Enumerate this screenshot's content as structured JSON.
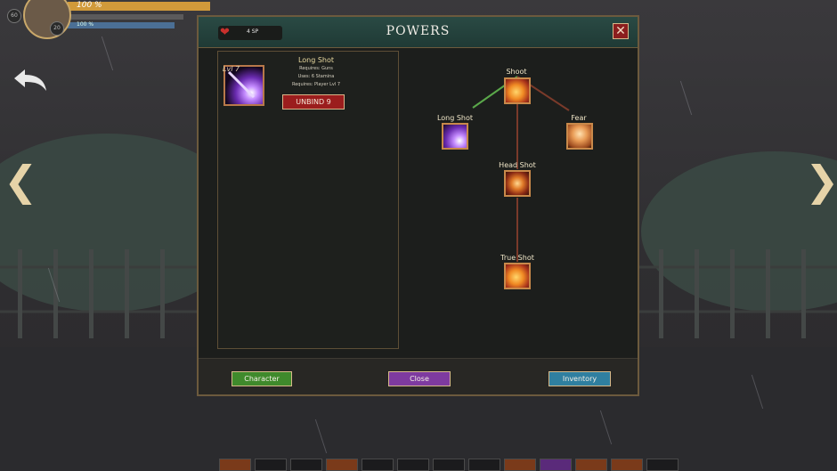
{
  "hud": {
    "hp_text": "100 %",
    "hp_fill_fraction": 1.0,
    "mana_text": "100 %",
    "level_badge_1": "60",
    "level_badge_2": "20"
  },
  "dialog": {
    "title": "POWERS",
    "sp_text": "4 SP",
    "close_symbol": "✕",
    "selected_power": {
      "level_label": "Lvl 7",
      "name": "Long Shot",
      "requires_weapon": "Requires: Guns",
      "uses": "Uses: 6 Stamina",
      "requires_level": "Requires: Player Lvl 7",
      "unbind_label": "UNBIND 9"
    },
    "tree": {
      "nodes": [
        {
          "id": "shoot",
          "label": "Shoot"
        },
        {
          "id": "long-shot",
          "label": "Long Shot"
        },
        {
          "id": "fear",
          "label": "Fear"
        },
        {
          "id": "head-shot",
          "label": "Head Shot"
        },
        {
          "id": "true-shot",
          "label": "True Shot"
        }
      ]
    },
    "footer": {
      "character_label": "Character",
      "close_label": "Close",
      "inventory_label": "Inventory"
    }
  },
  "colors": {
    "header_teal": "#2a4a44",
    "unbind_red": "#9b1d1d",
    "character_green": "#3f8a2c",
    "close_purple": "#7e3aa0",
    "inventory_blue": "#2f7fa0",
    "border_gold": "#c8894a"
  },
  "icons": {
    "back": "undo-arrow-icon",
    "left": "chevron-left-icon",
    "right": "chevron-right-icon",
    "sp": "heart-icon",
    "close": "close-icon"
  }
}
